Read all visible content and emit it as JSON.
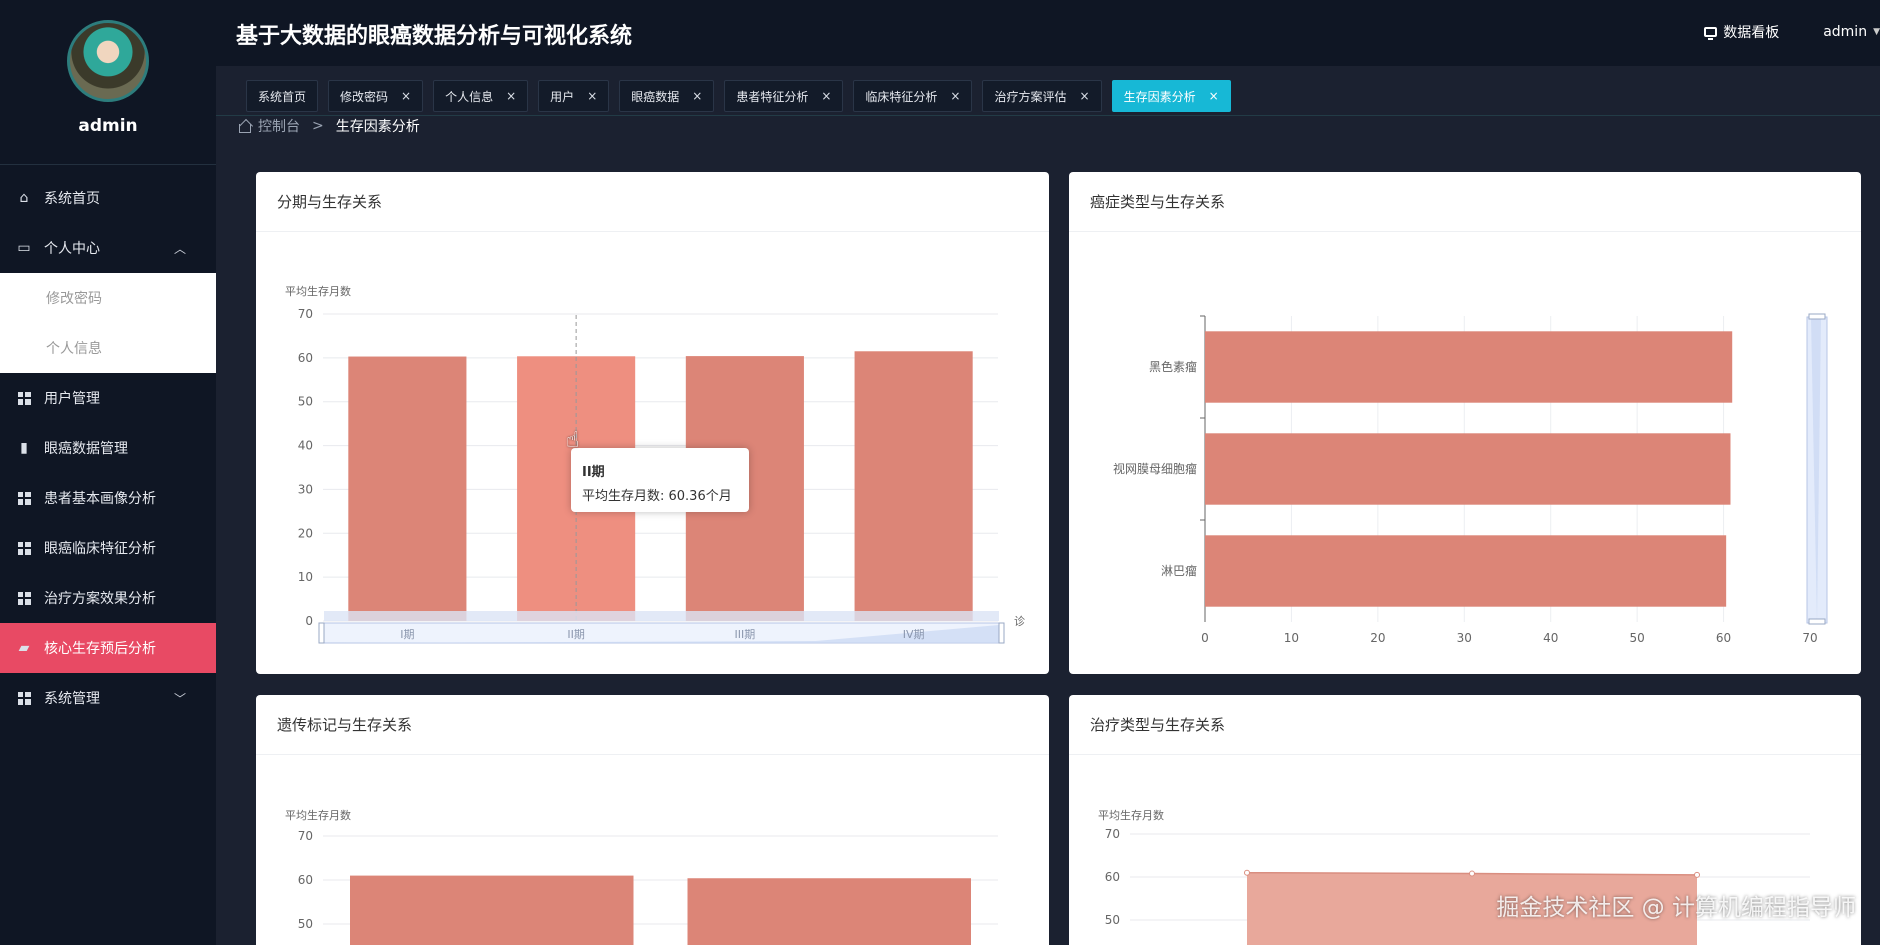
{
  "app_title": "基于大数据的眼癌数据分析与可视化系统",
  "header": {
    "dashboard_label": "数据看板",
    "user_label": "admin"
  },
  "profile": {
    "name": "admin"
  },
  "sidebar": {
    "items": [
      {
        "label": "系统首页",
        "icon": "home-icon"
      },
      {
        "label": "个人中心",
        "icon": "profile-card-icon",
        "expanded": true,
        "children": [
          {
            "label": "修改密码"
          },
          {
            "label": "个人信息"
          }
        ]
      },
      {
        "label": "用户管理",
        "icon": "grid-icon"
      },
      {
        "label": "眼癌数据管理",
        "icon": "bars-icon"
      },
      {
        "label": "患者基本画像分析",
        "icon": "grid-icon"
      },
      {
        "label": "眼癌临床特征分析",
        "icon": "grid-icon"
      },
      {
        "label": "治疗方案效果分析",
        "icon": "grid-icon"
      },
      {
        "label": "核心生存预后分析",
        "icon": "folder-icon",
        "active": true
      },
      {
        "label": "系统管理",
        "icon": "grid-icon"
      }
    ]
  },
  "tabs": [
    {
      "label": "系统首页",
      "closable": false
    },
    {
      "label": "修改密码",
      "closable": true
    },
    {
      "label": "个人信息",
      "closable": true
    },
    {
      "label": "用户",
      "closable": true
    },
    {
      "label": "眼癌数据",
      "closable": true
    },
    {
      "label": "患者特征分析",
      "closable": true
    },
    {
      "label": "临床特征分析",
      "closable": true
    },
    {
      "label": "治疗方案评估",
      "closable": true
    },
    {
      "label": "生存因素分析",
      "closable": true,
      "active": true
    }
  ],
  "tab_close_glyph": "×",
  "breadcrumb": {
    "root": "控制台",
    "separator": ">",
    "current": "生存因素分析"
  },
  "cards": {
    "stage": {
      "title": "分期与生存关系"
    },
    "cancer_type": {
      "title": "癌症类型与生存关系"
    },
    "genetic": {
      "title": "遗传标记与生存关系"
    },
    "treatment": {
      "title": "治疗类型与生存关系"
    }
  },
  "tooltip": {
    "title": "II期",
    "line": "平均生存月数: 60.36个月"
  },
  "watermark": "掘金技术社区 @ 计算机编程指导师",
  "colors": {
    "bar": "#dc8577",
    "bar_highlight": "#ee8f80",
    "active_tab": "#17b8d6",
    "active_menu": "#e84a64"
  },
  "chart_data": [
    {
      "type": "bar",
      "ylabel": "平均生存月数",
      "xlabel": "诊",
      "categories": [
        "I期",
        "II期",
        "III期",
        "IV期"
      ],
      "values": [
        60.3,
        60.36,
        60.4,
        61.5
      ],
      "ylim": [
        0,
        70
      ],
      "yticks": [
        "0",
        "10",
        "20",
        "30",
        "40",
        "50",
        "60",
        "70"
      ],
      "grid": true
    },
    {
      "type": "bar",
      "orientation": "horizontal",
      "categories": [
        "黑色素瘤",
        "视网膜母细胞瘤",
        "淋巴瘤"
      ],
      "values": [
        61,
        60.8,
        60.3
      ],
      "xlim": [
        0,
        70
      ],
      "xticks": [
        "0",
        "10",
        "20",
        "30",
        "40",
        "50",
        "60",
        "70"
      ],
      "grid": true
    },
    {
      "type": "bar",
      "ylabel": "平均生存月数",
      "categories": [
        "",
        ""
      ],
      "values": [
        61,
        60.4
      ],
      "ylim": [
        0,
        70
      ],
      "yticks": [
        "50",
        "60",
        "70"
      ],
      "grid": true
    },
    {
      "type": "area",
      "ylabel": "平均生存月数",
      "x": [
        "",
        "",
        ""
      ],
      "values": [
        61,
        60.8,
        60.5
      ],
      "ylim": [
        0,
        70
      ],
      "yticks": [
        "50",
        "60",
        "70"
      ],
      "grid": true
    }
  ]
}
